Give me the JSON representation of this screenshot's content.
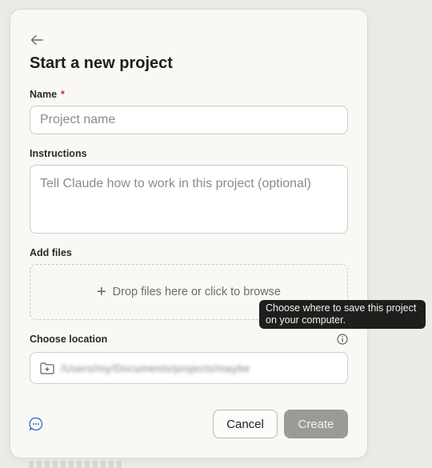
{
  "dialog": {
    "title": "Start a new project",
    "name_label": "Name",
    "required_mark": "*",
    "name_placeholder": "Project name",
    "instructions_label": "Instructions",
    "instructions_placeholder": "Tell Claude how to work in this project (optional)",
    "files_label": "Add files",
    "dropzone_text": "Drop files here or click to browse",
    "location_label": "Choose location",
    "location_path": "/Users/my/Documents/projects/maybe",
    "cancel_label": "Cancel",
    "create_label": "Create"
  },
  "tooltip": {
    "text": "Choose where to save this project on your computer."
  },
  "icons": [
    "arrow-left-icon",
    "plus-icon",
    "info-icon",
    "folder-plus-icon",
    "chat-bubble-icon"
  ],
  "colors": {
    "required": "#b3432c",
    "create_button_disabled": "#9b9a96",
    "tooltip_bg": "#1f1e1d",
    "accent_icon": "#3b74c9"
  }
}
